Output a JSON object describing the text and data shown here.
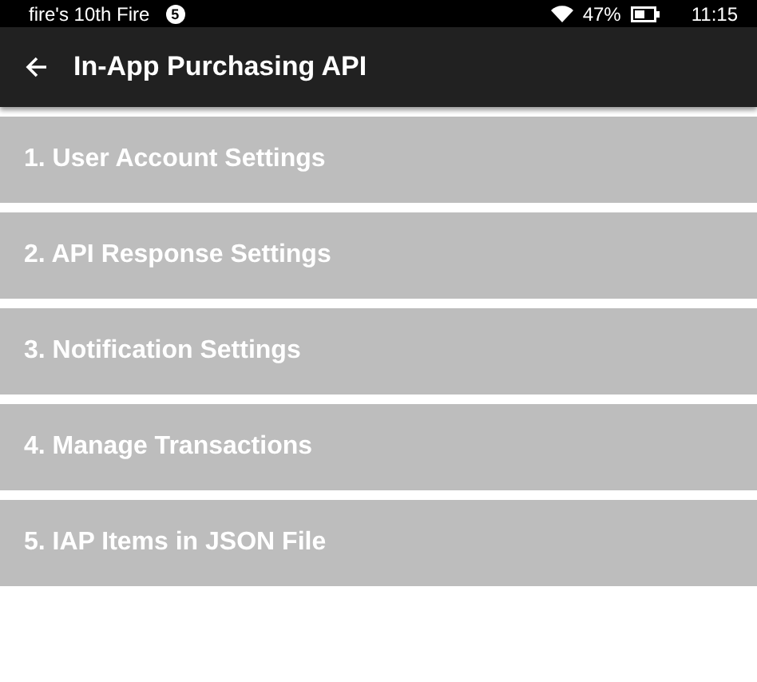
{
  "status_bar": {
    "device_name": "fire's 10th Fire",
    "notification_count": "5",
    "battery": "47%",
    "time": "11:15"
  },
  "app_bar": {
    "title": "In-App Purchasing API"
  },
  "menu_items": [
    {
      "label": "1. User Account Settings"
    },
    {
      "label": "2. API Response Settings"
    },
    {
      "label": "3. Notification Settings"
    },
    {
      "label": "4. Manage Transactions"
    },
    {
      "label": "5. IAP Items in JSON File"
    }
  ]
}
